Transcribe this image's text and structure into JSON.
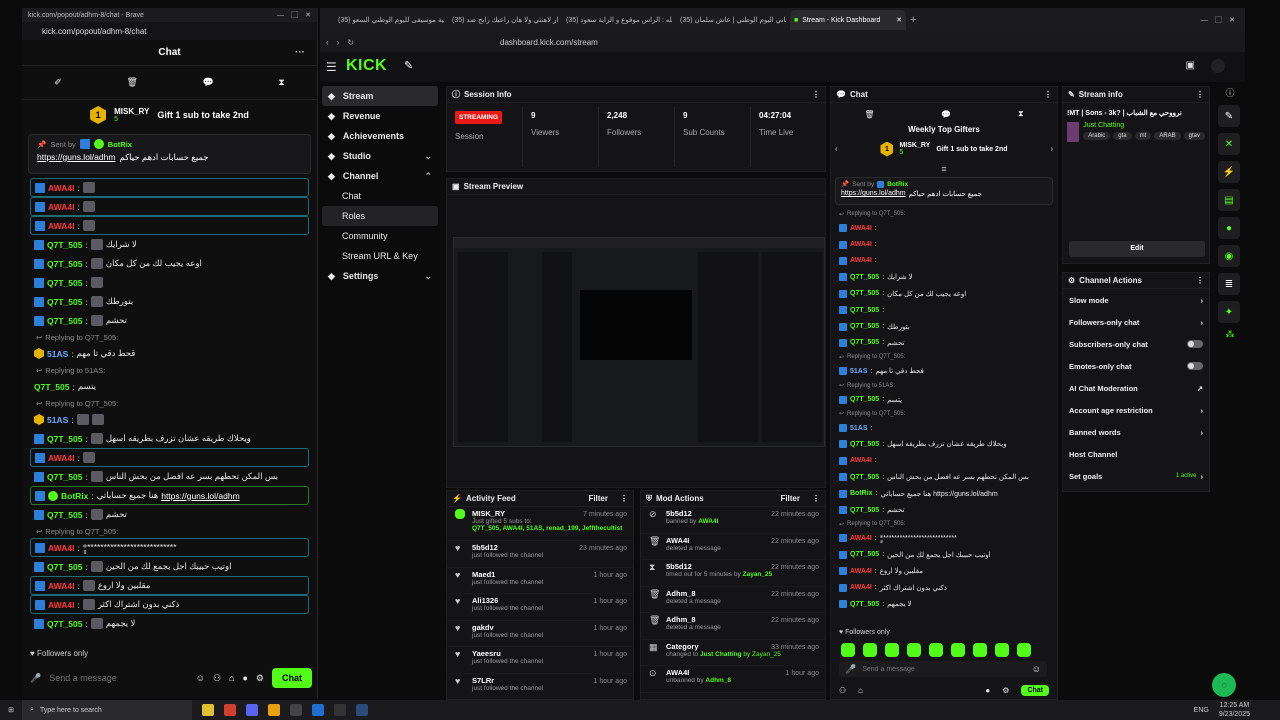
{
  "popout": {
    "title": "kick.com/popout/adhm-8/chat - Brave",
    "url": "kick.com/popout/adhm-8/chat",
    "chat_title": "Chat",
    "gifter": "MISK_RY",
    "gifter_count": "5",
    "gift_text": "Gift 1 sub to take 2nd",
    "sent_by": "Sent by",
    "pin_user": "BotRix",
    "pin_link": "https://guns.lol/adhm",
    "pin_text": "جميع حسابات ادهم حياكم",
    "messages": [
      {
        "u": "AWA4I",
        "t": "",
        "c": "r",
        "kind": "hl"
      },
      {
        "u": "AWA4I",
        "t": "",
        "c": "r",
        "kind": "hl"
      },
      {
        "u": "AWA4I",
        "t": "",
        "c": "r",
        "kind": "hl"
      },
      {
        "u": "Q7T_505",
        "t": "لا شرايك",
        "c": "g",
        "kind": "n"
      },
      {
        "u": "Q7T_505",
        "t": "اوعه يجيب لك من كل مكان",
        "c": "g",
        "kind": "n"
      },
      {
        "u": "Q7T_505",
        "t": "",
        "c": "g",
        "kind": "n"
      },
      {
        "u": "Q7T_505",
        "t": "بتورطك",
        "c": "g",
        "kind": "n"
      },
      {
        "u": "Q7T_505",
        "t": "تحشم",
        "c": "g",
        "kind": "n"
      }
    ],
    "reply1": "Replying to Q7T_505:",
    "r1_user": "51AS",
    "r1_text": "قحط دقي تا مهم",
    "reply2": "Replying to 51AS:",
    "r2_user": "Q7T_505",
    "r2_text": "يتسم",
    "reply3": "Replying to Q7T_505:",
    "r3_user": "51AS",
    "m_after": [
      {
        "u": "Q7T_505",
        "t": "ويحلاك طريقه عشان تزرف بطريقه اسهل",
        "c": "g",
        "kind": "n"
      },
      {
        "u": "AWA4I",
        "t": "",
        "c": "r",
        "kind": "hl"
      },
      {
        "u": "Q7T_505",
        "t": "بس المكن تحطهم بسر عه افضل من بحش الناس",
        "c": "g",
        "kind": "n"
      }
    ],
    "botrix_line": {
      "u": "BotRix",
      "t": "هنا جميع حساباتي",
      "link": "https://guns.lol/adhm"
    },
    "m_tail": [
      {
        "u": "Q7T_505",
        "t": "تحشم",
        "c": "g",
        "kind": "n"
      }
    ],
    "reply4": "Replying to Q7T_505:",
    "r4_user": "AWA4I",
    "r4_text": "ٍ*ٍ***************************",
    "m_end": [
      {
        "u": "Q7T_505",
        "t": "اوتيب حبيبك اجل يجمع لك من الحين",
        "c": "g",
        "kind": "n"
      },
      {
        "u": "AWA4I",
        "t": "مقلبين ولا اروع",
        "c": "r",
        "kind": "hl"
      },
      {
        "u": "AWA4I",
        "t": "ذكني بدون اشتراك اكثر",
        "c": "r",
        "kind": "hl"
      },
      {
        "u": "Q7T_505",
        "t": "لا يجمهم",
        "c": "g",
        "kind": "n"
      }
    ],
    "followers_only": "Followers only",
    "placeholder": "Send a message",
    "chat_btn": "Chat"
  },
  "tabs": [
    "(35) أغنية موسيقى لليوم الوطني السعو...",
    "(35) إذار لاهنتي ولا هان راعيك رابح ضد...",
    "(35) شيله : الراس موقوع و الراية سعود...",
    "(35) اغاني اليوم الوطني | عاش سلمان",
    "Stream - Kick Dashboard"
  ],
  "address": "dashboard.kick.com/stream",
  "logo": "KICK",
  "nav": [
    {
      "label": "Stream",
      "sel": true
    },
    {
      "label": "Revenue"
    },
    {
      "label": "Achievements"
    },
    {
      "label": "Studio",
      "chev": "⌄"
    },
    {
      "label": "Channel",
      "chev": "⌃"
    },
    {
      "label": "Chat",
      "sub": true
    },
    {
      "label": "Roles",
      "sub": true,
      "hov": true
    },
    {
      "label": "Community",
      "sub": true
    },
    {
      "label": "Stream URL & Key",
      "sub": true
    },
    {
      "label": "Settings",
      "chev": "⌄"
    }
  ],
  "session": {
    "title": "Session Info",
    "status": "STREAMING",
    "status_label": "Session",
    "stats": [
      {
        "v": "9",
        "l": "Viewers"
      },
      {
        "v": "2,248",
        "l": "Followers"
      },
      {
        "v": "9",
        "l": "Sub Counts"
      },
      {
        "v": "04:27:04",
        "l": "Time Live"
      }
    ]
  },
  "preview_title": "Stream Preview",
  "activity": {
    "title": "Activity Feed",
    "filter": "Filter",
    "items": [
      {
        "icon": "sub",
        "name": "MISK_RY",
        "desc": "Just gifted 5 subs to:",
        "extra": "Q7T_505, AWA4I, 51AS, renad_199, Jeffthecultist",
        "time": "7 minutes ago"
      },
      {
        "icon": "heart",
        "name": "5b5d12",
        "desc": "just followed the channel",
        "time": "23 minutes ago"
      },
      {
        "icon": "heart",
        "name": "Maed1",
        "desc": "just followed the channel",
        "time": "1 hour ago"
      },
      {
        "icon": "heart",
        "name": "Ali1326",
        "desc": "just followed the channel",
        "time": "1 hour ago"
      },
      {
        "icon": "heart",
        "name": "gakdv",
        "desc": "just followed the channel",
        "time": "1 hour ago"
      },
      {
        "icon": "heart",
        "name": "Yaeesru",
        "desc": "just followed the channel",
        "time": "1 hour ago"
      },
      {
        "icon": "heart",
        "name": "S7LRr",
        "desc": "just followed the channel",
        "time": "1 hour ago"
      }
    ]
  },
  "mod": {
    "title": "Mod Actions",
    "filter": "Filter",
    "items": [
      {
        "icon": "ban",
        "name": "5b5d12",
        "desc": "banned by",
        "by": "AWA4I",
        "time": "22 minutes ago"
      },
      {
        "icon": "trash",
        "name": "AWA4I",
        "desc": "deleted a message",
        "by": "",
        "time": "22 minutes ago"
      },
      {
        "icon": "timer",
        "name": "5b5d12",
        "desc": "timed out for 5 minutes by",
        "by": "Zayan_25",
        "time": "22 minutes ago"
      },
      {
        "icon": "trash",
        "name": "Adhm_8",
        "desc": "deleted a message",
        "by": "",
        "time": "22 minutes ago"
      },
      {
        "icon": "trash",
        "name": "Adhm_8",
        "desc": "deleted a message",
        "by": "",
        "time": "22 minutes ago"
      },
      {
        "icon": "cat",
        "name": "Category",
        "desc": "changed to",
        "by": "Just Chatting",
        "by2": "by Zayan_25",
        "time": "33 minutes ago"
      },
      {
        "icon": "unban",
        "name": "AWA4I",
        "desc": "unbanned by",
        "by": "Adhm_8",
        "time": "1 hour ago"
      }
    ]
  },
  "dchat": {
    "title": "Chat",
    "gifters_title": "Weekly Top Gifters",
    "gifter": "MISK_RY",
    "gifter_count": "5",
    "gift_text": "Gift 1 sub to take 2nd",
    "sent_by": "Sent by",
    "pin_user": "BotRix",
    "pin_link": "https://guns.lol/adhm",
    "pin_text": "جميع حسابات ادهم حياكم",
    "lines": [
      {
        "u": "",
        "t": "Replying to Q7T_505:",
        "c": "mut"
      },
      {
        "u": "AWA4I",
        "t": "",
        "c": "r"
      },
      {
        "u": "AWA4I",
        "t": "",
        "c": "r"
      },
      {
        "u": "AWA4I",
        "t": "",
        "c": "r"
      },
      {
        "u": "Q7T_505",
        "t": "لا شرايك",
        "c": "g"
      },
      {
        "u": "Q7T_505",
        "t": "اوعه يجيب لك من كل مكان",
        "c": "g"
      },
      {
        "u": "Q7T_505",
        "t": "",
        "c": "g"
      },
      {
        "u": "Q7T_505",
        "t": "بتورطك",
        "c": "g"
      },
      {
        "u": "Q7T_505",
        "t": "تحشم",
        "c": "g"
      },
      {
        "u": "",
        "t": "Replying to Q7T_505:",
        "c": "mut"
      },
      {
        "u": "51AS",
        "t": "قحط دقي تا مهم",
        "c": "b"
      },
      {
        "u": "",
        "t": "Replying to 51AS:",
        "c": "mut"
      },
      {
        "u": "Q7T_505",
        "t": "يتسم",
        "c": "g"
      },
      {
        "u": "",
        "t": "Replying to Q7T_505:",
        "c": "mut"
      },
      {
        "u": "51AS",
        "t": "",
        "c": "b"
      },
      {
        "u": "Q7T_505",
        "t": "ويحلاك طريقه عشان تزرف بطريقه اسهل",
        "c": "g"
      },
      {
        "u": "AWA4I",
        "t": "",
        "c": "r"
      },
      {
        "u": "Q7T_505",
        "t": "بس المكن تحطهم بسر عه افضل من بحش الناس",
        "c": "g"
      },
      {
        "u": "BotRix",
        "t": "هنا جميع حساباتي https://guns.lol/adhm",
        "c": "g"
      },
      {
        "u": "Q7T_505",
        "t": "تحشم",
        "c": "g"
      },
      {
        "u": "",
        "t": "Replying to Q7T_505:",
        "c": "mut"
      },
      {
        "u": "AWA4I",
        "t": "ٍ*ٍ***************************",
        "c": "r"
      },
      {
        "u": "Q7T_505",
        "t": "اوتيب حبيبك اجل يجمع لك من الحين",
        "c": "g"
      },
      {
        "u": "AWA4I",
        "t": "مقلبين ولا اروع",
        "c": "r"
      },
      {
        "u": "AWA4I",
        "t": "ذكني بدون اشتراك اكثر",
        "c": "r"
      },
      {
        "u": "Q7T_505",
        "t": "لا يجمهم",
        "c": "g"
      }
    ],
    "followers_only": "Followers only",
    "placeholder": "Send a message",
    "chat_btn": "Chat"
  },
  "info": {
    "title": "Stream info",
    "stream_title": "!MT | Sons - 3k? | نرووحي مع الشباب",
    "category": "Just Chatting",
    "tags": [
      "Arabic",
      "gta",
      "mt",
      "ARAB",
      "gtav"
    ],
    "edit": "Edit"
  },
  "actions": {
    "title": "Channel Actions",
    "items": [
      {
        "label": "Slow mode",
        "ctl": "chev"
      },
      {
        "label": "Followers-only chat",
        "ctl": "chev"
      },
      {
        "label": "Subscribers-only chat",
        "ctl": "toggle"
      },
      {
        "label": "Emotes-only chat",
        "ctl": "toggle"
      },
      {
        "label": "AI Chat Moderation",
        "ctl": "ext"
      },
      {
        "label": "Account age restriction",
        "ctl": "chev"
      },
      {
        "label": "Banned words",
        "ctl": "chev"
      },
      {
        "label": "Host Channel",
        "ctl": ""
      },
      {
        "label": "Set goals",
        "ctl": "chev",
        "note": "1 active"
      }
    ]
  },
  "taskbar": {
    "search": "Type here to search",
    "time": "12:25 AM",
    "date": "9/23/2025",
    "lang": "ENG"
  }
}
